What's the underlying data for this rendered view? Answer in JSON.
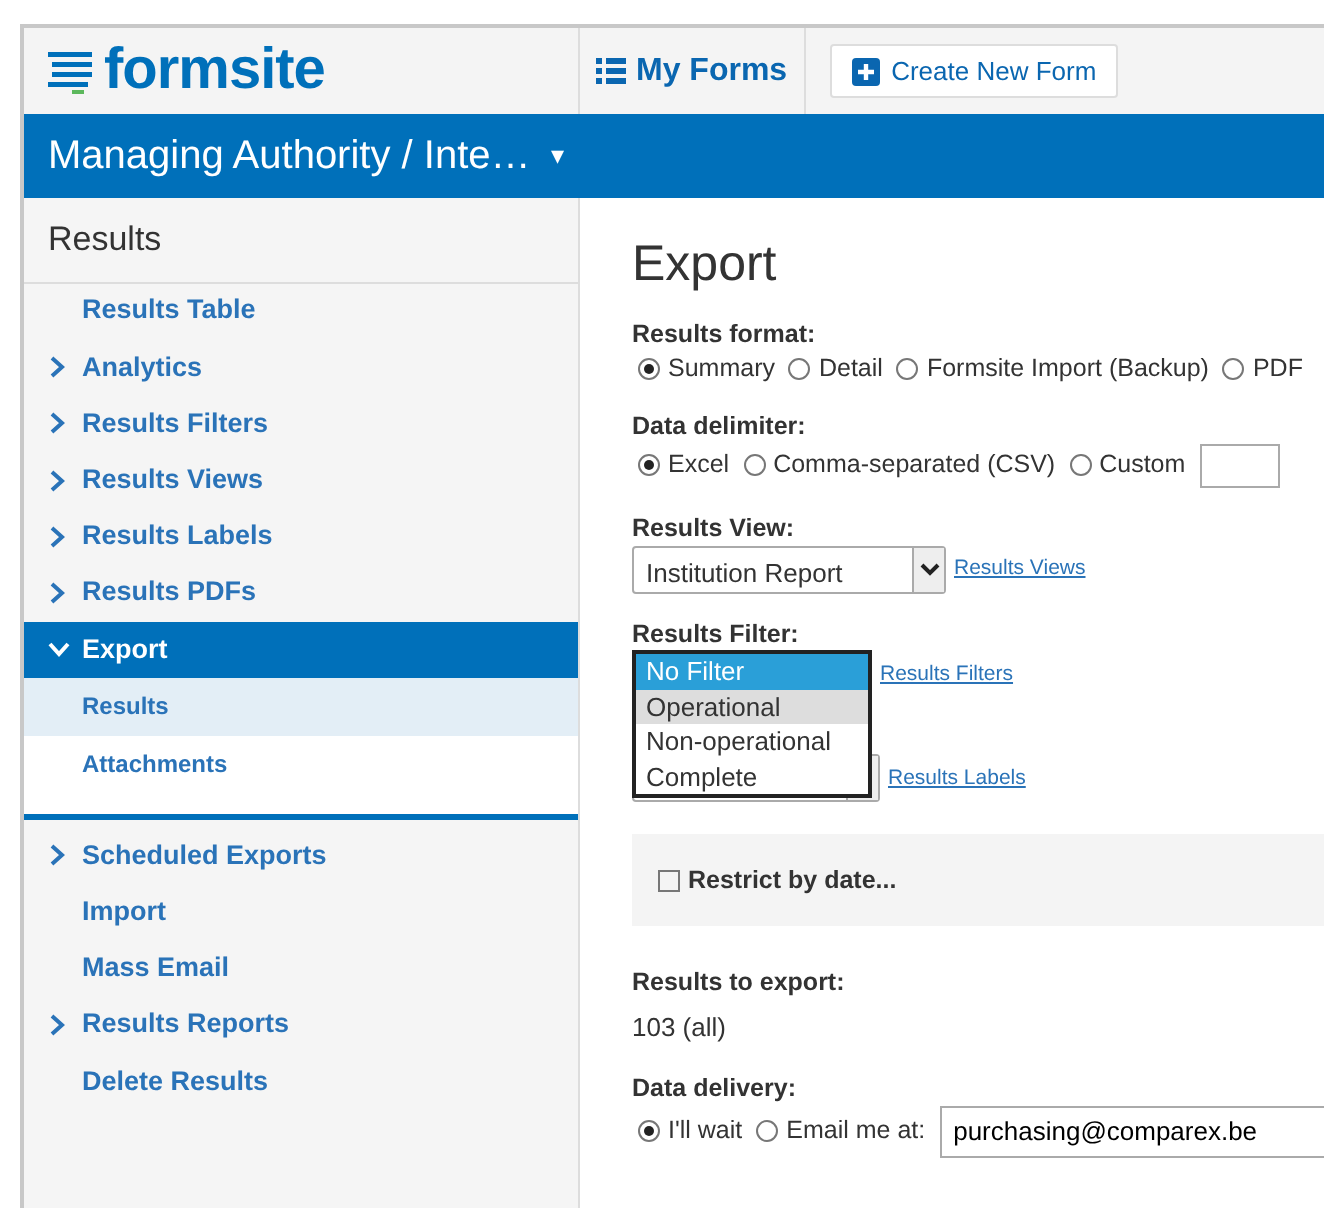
{
  "header": {
    "logo": "formsite",
    "my_forms": "My Forms",
    "create_button": "Create New Form"
  },
  "form_bar": {
    "title": "Managing Authority / Inte…",
    "caret": "▾"
  },
  "sidebar": {
    "title": "Results",
    "items": [
      {
        "label": "Results Table",
        "expandable": false,
        "expanded": false,
        "selected": false
      },
      {
        "label": "Analytics",
        "expandable": true,
        "expanded": false,
        "selected": false
      },
      {
        "label": "Results Filters",
        "expandable": true,
        "expanded": false,
        "selected": false
      },
      {
        "label": "Results Views",
        "expandable": true,
        "expanded": false,
        "selected": false
      },
      {
        "label": "Results Labels",
        "expandable": true,
        "expanded": false,
        "selected": false
      },
      {
        "label": "Results PDFs",
        "expandable": true,
        "expanded": false,
        "selected": false
      },
      {
        "label": "Export",
        "expandable": true,
        "expanded": true,
        "selected": true,
        "children": [
          {
            "label": "Results",
            "selected": true
          },
          {
            "label": "Attachments",
            "selected": false
          }
        ]
      },
      {
        "label": "Scheduled Exports",
        "expandable": true,
        "expanded": false,
        "selected": false
      },
      {
        "label": "Import",
        "expandable": false,
        "expanded": false,
        "selected": false
      },
      {
        "label": "Mass Email",
        "expandable": false,
        "expanded": false,
        "selected": false
      },
      {
        "label": "Results Reports",
        "expandable": true,
        "expanded": false,
        "selected": false
      },
      {
        "label": "Delete Results",
        "expandable": false,
        "expanded": false,
        "selected": false
      }
    ]
  },
  "main": {
    "title": "Export",
    "results_format": {
      "label": "Results format:",
      "options": [
        {
          "label": "Summary",
          "selected": true
        },
        {
          "label": "Detail",
          "selected": false
        },
        {
          "label": "Formsite Import (Backup)",
          "selected": false
        },
        {
          "label": "PDF",
          "selected": false
        }
      ]
    },
    "data_delimiter": {
      "label": "Data delimiter:",
      "options": [
        {
          "label": "Excel",
          "selected": true
        },
        {
          "label": "Comma-separated (CSV)",
          "selected": false
        },
        {
          "label": "Custom",
          "selected": false
        }
      ]
    },
    "results_view": {
      "label": "Results View:",
      "value": "Institution Report",
      "link": "Results Views"
    },
    "results_filter": {
      "label": "Results Filter:",
      "link": "Results Filters",
      "options": [
        {
          "label": "No Filter",
          "selected": true,
          "hovered": false
        },
        {
          "label": "Operational",
          "selected": false,
          "hovered": true
        },
        {
          "label": "Non-operational",
          "selected": false,
          "hovered": false
        },
        {
          "label": "Complete",
          "selected": false,
          "hovered": false
        }
      ]
    },
    "results_labels": {
      "link": "Results Labels"
    },
    "restrict_by_date": {
      "label": "Restrict by date...",
      "checked": false
    },
    "results_to_export": {
      "label": "Results to export:",
      "value": "103 (all)"
    },
    "data_delivery": {
      "label": "Data delivery:",
      "options": [
        {
          "label": "I'll wait",
          "selected": true
        },
        {
          "label": "Email me at:",
          "selected": false
        }
      ],
      "email": "purchasing@comparex.be"
    }
  }
}
